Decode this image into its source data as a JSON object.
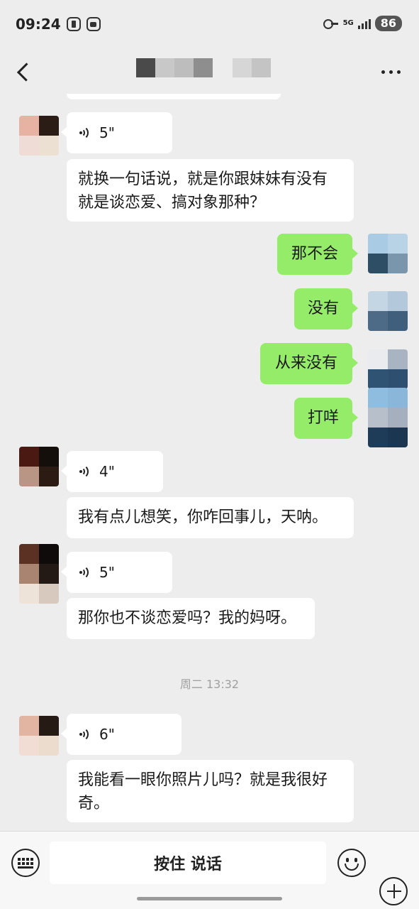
{
  "status_bar": {
    "time": "09:24",
    "network": "5G",
    "battery": "86"
  },
  "nav": {
    "back_icon": "back-chevron-icon",
    "more_icon": "more-dots-icon"
  },
  "messages": {
    "voice_1_duration": "5\"",
    "text_1": "就换一句话说，就是你跟妹妹有没有就是谈恋爱、搞对象那种？",
    "reply_1": "那不会",
    "reply_2": "没有",
    "reply_3": "从来没有",
    "reply_4": "打咩",
    "voice_2_duration": "4\"",
    "text_2": "我有点儿想笑，你咋回事儿，天呐。",
    "voice_3_duration": "5\"",
    "text_3": "那你也不谈恋爱吗？我的妈呀。",
    "timestamp": "周二 13:32",
    "voice_4_duration": "6\"",
    "text_4": "我能看一眼你照片儿吗？就是我很好奇。"
  },
  "input_bar": {
    "hold_to_talk": "按住 说话",
    "keyboard_icon": "keyboard-icon",
    "emoji_icon": "emoji-icon",
    "plus_icon": "plus-icon"
  }
}
